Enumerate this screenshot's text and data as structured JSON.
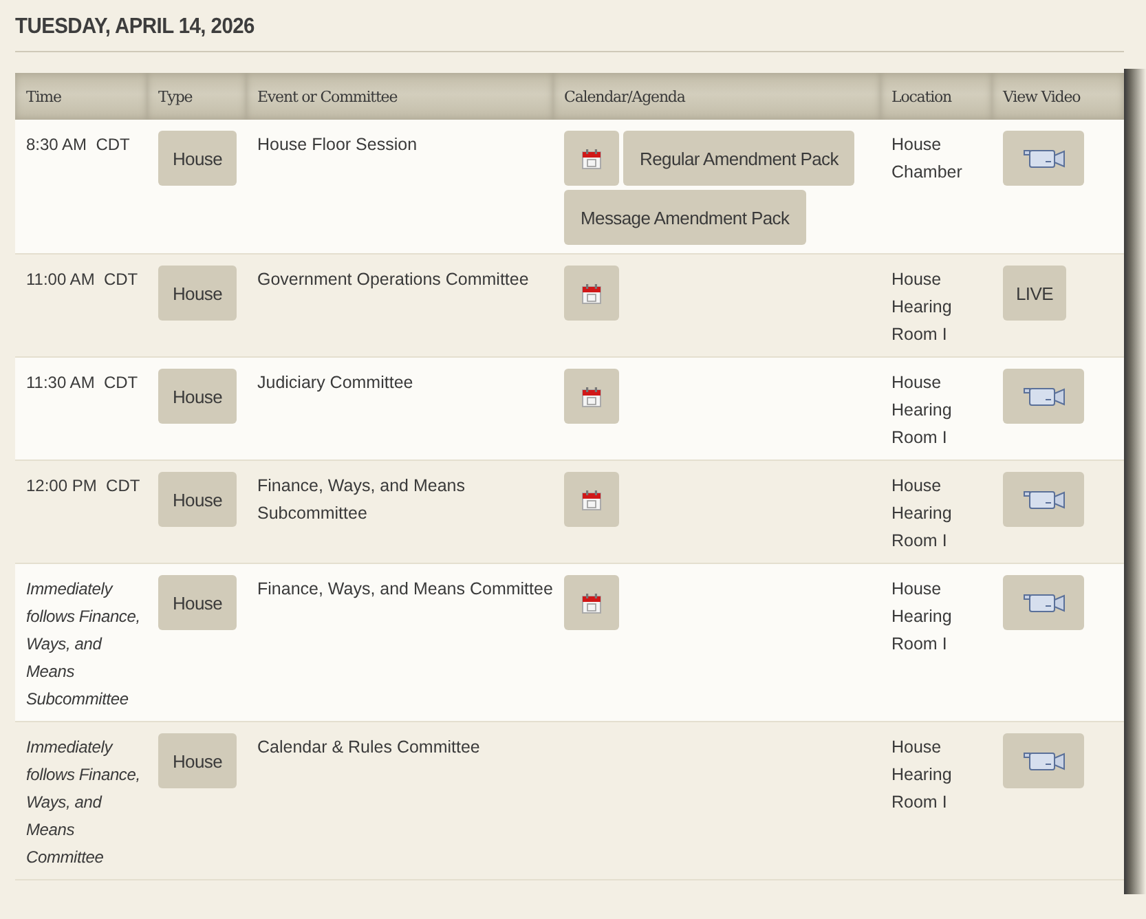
{
  "date_heading": "TUESDAY, APRIL 14, 2026",
  "table": {
    "columns": [
      "Time",
      "Type",
      "Event or Committee",
      "Calendar/Agenda",
      "Location",
      "View Video"
    ],
    "rows": [
      {
        "time": "8:30 AM  CDT",
        "italic": false,
        "type": "House",
        "event": "House Floor Session",
        "calendar": true,
        "agenda_links": [
          "Regular Amendment Pack",
          "Message Amendment Pack"
        ],
        "location": "House Chamber",
        "video": {
          "kind": "camera"
        }
      },
      {
        "time": "11:00 AM  CDT",
        "italic": false,
        "type": "House",
        "event": "Government Operations Committee",
        "calendar": true,
        "location": "House Hearing Room I",
        "video": {
          "kind": "live",
          "label": "LIVE"
        }
      },
      {
        "time": "11:30 AM  CDT",
        "italic": false,
        "type": "House",
        "event": "Judiciary Committee",
        "calendar": true,
        "location": "House Hearing Room I",
        "video": {
          "kind": "camera"
        }
      },
      {
        "time": "12:00 PM  CDT",
        "italic": false,
        "type": "House",
        "event": "Finance, Ways, and Means Subcommittee",
        "calendar": true,
        "location": "House Hearing Room I",
        "video": {
          "kind": "camera"
        }
      },
      {
        "time": "Immediately follows Finance, Ways, and Means Subcommittee",
        "italic": true,
        "type": "House",
        "event": "Finance, Ways, and Means Committee",
        "calendar": true,
        "location": "House Hearing Room I",
        "video": {
          "kind": "camera"
        }
      },
      {
        "time": "Immediately follows Finance, Ways, and Means Committee",
        "italic": true,
        "type": "House",
        "event": "Calendar & Rules Committee",
        "calendar": false,
        "location": "House Hearing Room I",
        "video": {
          "kind": "camera"
        }
      }
    ]
  }
}
